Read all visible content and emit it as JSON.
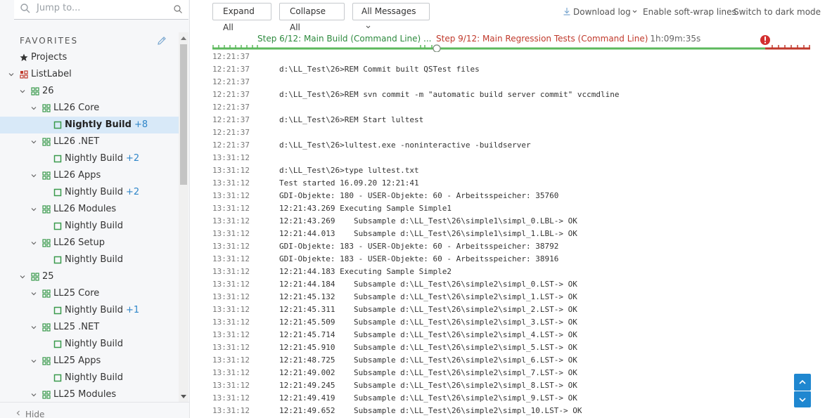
{
  "search": {
    "placeholder": "Jump to..."
  },
  "sidebar": {
    "favorites_header": "FAVORITES",
    "hide_label": "Hide",
    "tree": [
      {
        "label": "Projects",
        "level": 0,
        "icon": "star-icon",
        "chevron": "none"
      },
      {
        "label": "ListLabel",
        "level": 0,
        "icon": "project-icon",
        "chevron": "down"
      },
      {
        "label": "26",
        "level": 1,
        "icon": "grid-icon",
        "chevron": "down"
      },
      {
        "label": "LL26 Core",
        "level": 2,
        "icon": "grid-icon",
        "chevron": "down"
      },
      {
        "label": "Nightly Build",
        "level": 3,
        "icon": "build-config-icon",
        "chevron": "none",
        "extra": "+8",
        "selected": true
      },
      {
        "label": "LL26 .NET",
        "level": 2,
        "icon": "grid-icon",
        "chevron": "down"
      },
      {
        "label": "Nightly Build",
        "level": 3,
        "icon": "build-config-icon",
        "chevron": "none",
        "extra": "+2"
      },
      {
        "label": "LL26 Apps",
        "level": 2,
        "icon": "grid-icon",
        "chevron": "down"
      },
      {
        "label": "Nightly Build",
        "level": 3,
        "icon": "build-config-icon",
        "chevron": "none",
        "extra": "+2"
      },
      {
        "label": "LL26 Modules",
        "level": 2,
        "icon": "grid-icon",
        "chevron": "down"
      },
      {
        "label": "Nightly Build",
        "level": 3,
        "icon": "build-config-icon",
        "chevron": "none"
      },
      {
        "label": "LL26 Setup",
        "level": 2,
        "icon": "grid-icon",
        "chevron": "down"
      },
      {
        "label": "Nightly Build",
        "level": 3,
        "icon": "build-config-icon",
        "chevron": "none"
      },
      {
        "label": "25",
        "level": 1,
        "icon": "grid-icon",
        "chevron": "down"
      },
      {
        "label": "LL25 Core",
        "level": 2,
        "icon": "grid-icon",
        "chevron": "down"
      },
      {
        "label": "Nightly Build",
        "level": 3,
        "icon": "build-config-icon",
        "chevron": "none",
        "extra": "+1"
      },
      {
        "label": "LL25 .NET",
        "level": 2,
        "icon": "grid-icon",
        "chevron": "down"
      },
      {
        "label": "Nightly Build",
        "level": 3,
        "icon": "build-config-icon",
        "chevron": "none"
      },
      {
        "label": "LL25 Apps",
        "level": 2,
        "icon": "grid-icon",
        "chevron": "down"
      },
      {
        "label": "Nightly Build",
        "level": 3,
        "icon": "build-config-icon",
        "chevron": "none"
      },
      {
        "label": "LL25 Modules",
        "level": 2,
        "icon": "grid-icon",
        "chevron": "down"
      }
    ]
  },
  "toolbar": {
    "expand_all": "Expand All",
    "collapse_all": "Collapse All",
    "all_messages": "All Messages",
    "download_log": "Download log",
    "soft_wrap": "Enable soft-wrap lines",
    "dark_mode": "Switch to dark mode"
  },
  "timeline": {
    "step6_label": "Step 6/12: Main Build (Command Line) ...",
    "step9_label": "Step 9/12: Main Regression Tests (Command Line)",
    "step9_duration": "1h:09m:35s",
    "success_color": "#5cb85c",
    "failure_color": "#c0392b"
  },
  "log": [
    {
      "ts": "12:21:37",
      "msg": ""
    },
    {
      "ts": "12:21:37",
      "msg": "d:\\LL_Test\\26>REM Commit built QSTest files"
    },
    {
      "ts": "12:21:37",
      "msg": ""
    },
    {
      "ts": "12:21:37",
      "msg": "d:\\LL_Test\\26>REM svn commit -m \"automatic build server commit\" vccmdline"
    },
    {
      "ts": "12:21:37",
      "msg": ""
    },
    {
      "ts": "12:21:37",
      "msg": "d:\\LL_Test\\26>REM Start lultest"
    },
    {
      "ts": "12:21:37",
      "msg": ""
    },
    {
      "ts": "12:21:37",
      "msg": "d:\\LL_Test\\26>lultest.exe -noninteractive -buildserver"
    },
    {
      "ts": "13:31:12",
      "msg": ""
    },
    {
      "ts": "13:31:12",
      "msg": "d:\\LL_Test\\26>type lultest.txt"
    },
    {
      "ts": "13:31:12",
      "msg": "Test started 16.09.20 12:21:41"
    },
    {
      "ts": "13:31:12",
      "msg": "GDI-Objekte: 180 - USER-Objekte: 60 - Arbeitsspeicher: 35760"
    },
    {
      "ts": "13:31:12",
      "msg": "12:21:43.269 Executing Sample Simple1"
    },
    {
      "ts": "13:31:12",
      "msg": "12:21:43.269    Subsample d:\\LL_Test\\26\\simple1\\simpl_0.LBL-> OK"
    },
    {
      "ts": "13:31:12",
      "msg": "12:21:44.013    Subsample d:\\LL_Test\\26\\simple1\\simpl_1.LBL-> OK"
    },
    {
      "ts": "13:31:12",
      "msg": "GDI-Objekte: 183 - USER-Objekte: 60 - Arbeitsspeicher: 38792"
    },
    {
      "ts": "13:31:12",
      "msg": "GDI-Objekte: 183 - USER-Objekte: 60 - Arbeitsspeicher: 38916"
    },
    {
      "ts": "13:31:12",
      "msg": "12:21:44.183 Executing Sample Simple2"
    },
    {
      "ts": "13:31:12",
      "msg": "12:21:44.184    Subsample d:\\LL_Test\\26\\simple2\\simpl_0.LST-> OK"
    },
    {
      "ts": "13:31:12",
      "msg": "12:21:45.132    Subsample d:\\LL_Test\\26\\simple2\\simpl_1.LST-> OK"
    },
    {
      "ts": "13:31:12",
      "msg": "12:21:45.311    Subsample d:\\LL_Test\\26\\simple2\\simpl_2.LST-> OK"
    },
    {
      "ts": "13:31:12",
      "msg": "12:21:45.509    Subsample d:\\LL_Test\\26\\simple2\\simpl_3.LST-> OK"
    },
    {
      "ts": "13:31:12",
      "msg": "12:21:45.714    Subsample d:\\LL_Test\\26\\simple2\\simpl_4.LST-> OK"
    },
    {
      "ts": "13:31:12",
      "msg": "12:21:45.910    Subsample d:\\LL_Test\\26\\simple2\\simpl_5.LST-> OK"
    },
    {
      "ts": "13:31:12",
      "msg": "12:21:48.725    Subsample d:\\LL_Test\\26\\simple2\\simpl_6.LST-> OK"
    },
    {
      "ts": "13:31:12",
      "msg": "12:21:49.002    Subsample d:\\LL_Test\\26\\simple2\\simpl_7.LST-> OK"
    },
    {
      "ts": "13:31:12",
      "msg": "12:21:49.245    Subsample d:\\LL_Test\\26\\simple2\\simpl_8.LST-> OK"
    },
    {
      "ts": "13:31:12",
      "msg": "12:21:49.419    Subsample d:\\LL_Test\\26\\simple2\\simpl_9.LST-> OK"
    },
    {
      "ts": "13:31:12",
      "msg": "12:21:49.652    Subsample d:\\LL_Test\\26\\simple2\\simpl_10.LST-> OK"
    }
  ]
}
